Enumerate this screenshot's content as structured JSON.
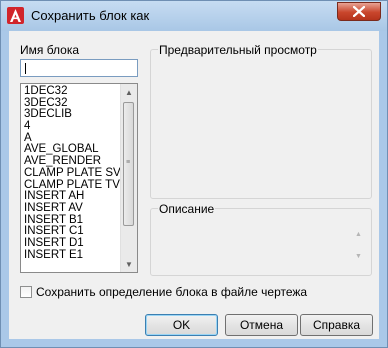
{
  "window": {
    "title": "Сохранить блок как",
    "app_icon": "autocad-a-icon",
    "close_icon": "close-x-icon"
  },
  "block_name": {
    "label": "Имя блока",
    "value": ""
  },
  "block_list": {
    "items": [
      "1DEC32",
      "3DEC32",
      "3DECLIB",
      "4",
      "A",
      "AVE_GLOBAL",
      "AVE_RENDER",
      "CLAMP PLATE SV",
      "CLAMP PLATE TV",
      "INSERT AH",
      "INSERT AV",
      "INSERT B1",
      "INSERT C1",
      "INSERT D1",
      "INSERT E1"
    ]
  },
  "preview": {
    "label": "Предварительный просмотр"
  },
  "description": {
    "label": "Описание"
  },
  "save_definition": {
    "label": "Сохранить определение блока в файле чертежа",
    "checked": false
  },
  "buttons": {
    "ok": "OK",
    "cancel": "Отмена",
    "help": "Справка"
  }
}
